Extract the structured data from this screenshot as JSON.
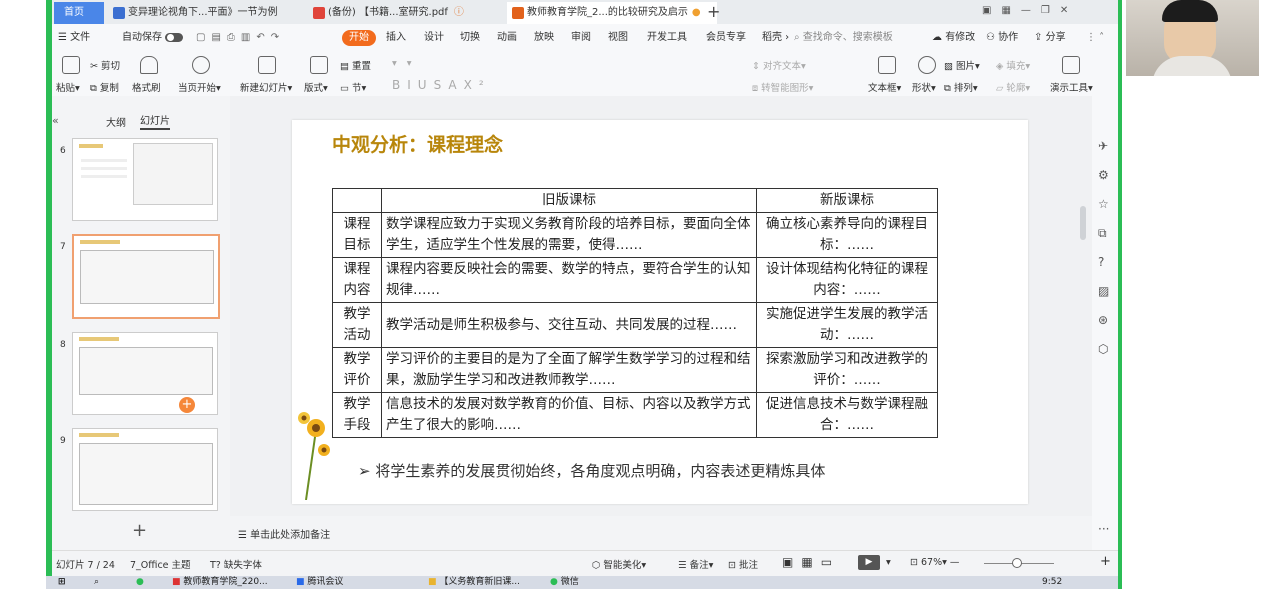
{
  "tabs": {
    "home": "首页",
    "t1": "变异理论视角下...平面》一节为例",
    "t2": "(备份) 【书籍...室研究.pdf",
    "t3": "教师教育学院_2...的比较研究及启示"
  },
  "menu": {
    "file": "文件",
    "autosave": "自动保存",
    "start": "开始",
    "items": [
      "插入",
      "设计",
      "切换",
      "动画",
      "放映",
      "审阅",
      "视图",
      "开发工具",
      "会员专享",
      "稻壳"
    ],
    "search": "查找命令、搜索模板",
    "modified": "有修改",
    "collab": "协作",
    "share": "分享"
  },
  "toolbar": {
    "paste": "粘贴",
    "cut": "剪切",
    "copy": "复制",
    "format": "格式刷",
    "from_current": "当页开始",
    "new_slide": "新建幻灯片",
    "layout": "版式",
    "section": "节",
    "reset": "重置",
    "textbox": "文本框",
    "shape": "形状",
    "arrange": "排列",
    "picture": "图片",
    "fill": "填充",
    "outline": "轮廓",
    "tools": "演示工具",
    "align_text": "对齐文本",
    "smart": "转智能图形"
  },
  "panel": {
    "tab_outline": "大纲",
    "tab_slides": "幻灯片",
    "thumbs": [
      "6",
      "7",
      "8",
      "9"
    ]
  },
  "slide": {
    "title": "中观分析：课程理念",
    "header": [
      "旧版课标",
      "新版课标"
    ],
    "rows": [
      {
        "h": "课程目标",
        "old": "数学课程应致力于实现义务教育阶段的培养目标，要面向全体学生，适应学生个性发展的需要，使得……",
        "new": "确立核心素养导向的课程目标：……"
      },
      {
        "h": "课程内容",
        "old": "课程内容要反映社会的需要、数学的特点，要符合学生的认知规律……",
        "new": "设计体现结构化特征的课程内容：……"
      },
      {
        "h": "教学活动",
        "old": "教学活动是师生积极参与、交往互动、共同发展的过程……",
        "new": "实施促进学生发展的教学活动：……"
      },
      {
        "h": "教学评价",
        "old": "学习评价的主要目的是为了全面了解学生数学学习的过程和结果，激励学生学习和改进教师教学……",
        "new": "探索激励学习和改进教学的评价：……"
      },
      {
        "h": "教学手段",
        "old": "信息技术的发展对数学教育的价值、目标、内容以及教学方式产生了很大的影响……",
        "new": "促进信息技术与数学课程融合：……"
      }
    ],
    "summary": "➢ 将学生素养的发展贯彻始终，各角度观点明确，内容表述更精炼具体"
  },
  "notes": "单击此处添加备注",
  "status": {
    "slide_count": "幻灯片 7 / 24",
    "theme": "7_Office 主题",
    "missing_font": "缺失字体",
    "beautify": "智能美化",
    "notes_btn": "备注",
    "comments": "批注",
    "zoom": "67%"
  },
  "taskbar": {
    "a1": "教师教育学院_220...",
    "a2": "腾讯会议",
    "a3": "【义务教育新旧课...",
    "a4": "微信",
    "time": "9:52"
  },
  "colors": {
    "accent": "#f26b1d",
    "title": "#b8860b",
    "green": "#2bbd55"
  }
}
